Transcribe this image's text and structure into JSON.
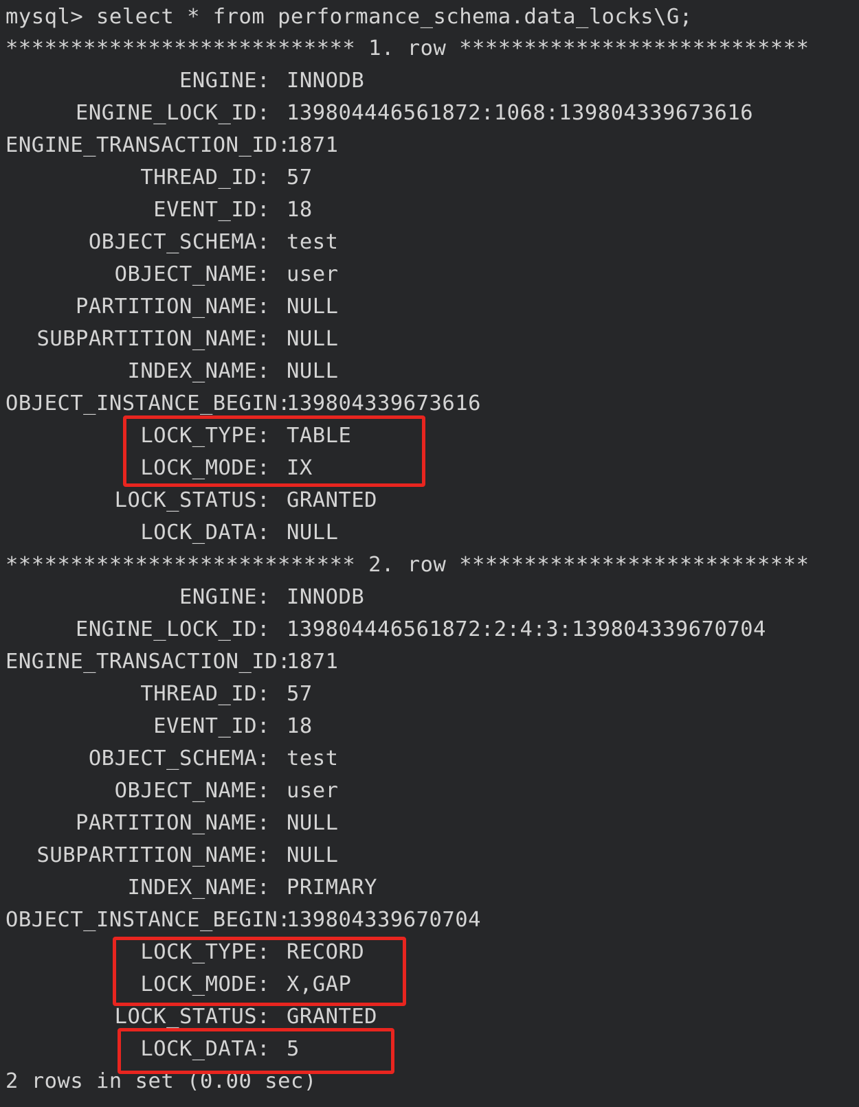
{
  "terminal": {
    "command_line": "mysql> select * from performance_schema.data_locks\\G;",
    "rows": [
      {
        "separator": "*************************** 1. row ***************************",
        "fields": [
          {
            "label": "ENGINE:",
            "value": "INNODB"
          },
          {
            "label": "ENGINE_LOCK_ID:",
            "value": "139804446561872:1068:139804339673616"
          },
          {
            "label": "ENGINE_TRANSACTION_ID:",
            "value": "1871"
          },
          {
            "label": "THREAD_ID:",
            "value": "57"
          },
          {
            "label": "EVENT_ID:",
            "value": "18"
          },
          {
            "label": "OBJECT_SCHEMA:",
            "value": "test"
          },
          {
            "label": "OBJECT_NAME:",
            "value": "user"
          },
          {
            "label": "PARTITION_NAME:",
            "value": "NULL"
          },
          {
            "label": "SUBPARTITION_NAME:",
            "value": "NULL"
          },
          {
            "label": "INDEX_NAME:",
            "value": "NULL"
          },
          {
            "label": "OBJECT_INSTANCE_BEGIN:",
            "value": "139804339673616"
          },
          {
            "label": "LOCK_TYPE:",
            "value": "TABLE"
          },
          {
            "label": "LOCK_MODE:",
            "value": "IX"
          },
          {
            "label": "LOCK_STATUS:",
            "value": "GRANTED"
          },
          {
            "label": "LOCK_DATA:",
            "value": "NULL"
          }
        ]
      },
      {
        "separator": "*************************** 2. row ***************************",
        "fields": [
          {
            "label": "ENGINE:",
            "value": "INNODB"
          },
          {
            "label": "ENGINE_LOCK_ID:",
            "value": "139804446561872:2:4:3:139804339670704"
          },
          {
            "label": "ENGINE_TRANSACTION_ID:",
            "value": "1871"
          },
          {
            "label": "THREAD_ID:",
            "value": "57"
          },
          {
            "label": "EVENT_ID:",
            "value": "18"
          },
          {
            "label": "OBJECT_SCHEMA:",
            "value": "test"
          },
          {
            "label": "OBJECT_NAME:",
            "value": "user"
          },
          {
            "label": "PARTITION_NAME:",
            "value": "NULL"
          },
          {
            "label": "SUBPARTITION_NAME:",
            "value": "NULL"
          },
          {
            "label": "INDEX_NAME:",
            "value": "PRIMARY"
          },
          {
            "label": "OBJECT_INSTANCE_BEGIN:",
            "value": "139804339670704"
          },
          {
            "label": "LOCK_TYPE:",
            "value": "RECORD"
          },
          {
            "label": "LOCK_MODE:",
            "value": "X,GAP"
          },
          {
            "label": "LOCK_STATUS:",
            "value": "GRANTED"
          },
          {
            "label": "LOCK_DATA:",
            "value": "5"
          }
        ]
      }
    ],
    "footer": "2 rows in set (0.00 sec)"
  },
  "colors": {
    "background": "#262729",
    "text": "#d4d4d4",
    "highlight": "#e8251f"
  }
}
